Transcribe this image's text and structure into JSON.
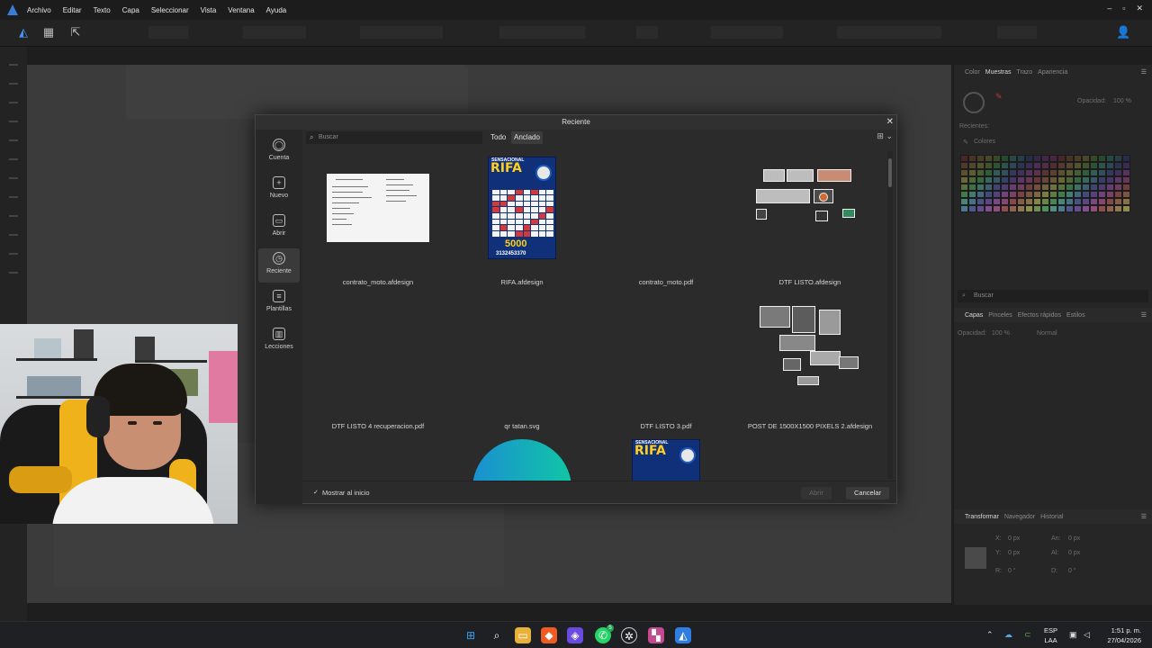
{
  "menu": [
    "Archivo",
    "Editar",
    "Texto",
    "Capa",
    "Seleccionar",
    "Vista",
    "Ventana",
    "Ayuda"
  ],
  "window_controls": [
    "–",
    "▫",
    "✕"
  ],
  "color_panel": {
    "tabs": [
      "Color",
      "Muestras",
      "Trazo",
      "Apariencia"
    ],
    "active_tab": "Muestras",
    "opacity_label": "Opacidad:",
    "opacity_value": "100 %",
    "recent_label": "Recientes:",
    "palette_label": "Colores",
    "search_placeholder": "Buscar"
  },
  "layers_panel": {
    "tabs": [
      "Capas",
      "Pinceles",
      "Efectos rápidos",
      "Estilos"
    ],
    "active_tab": "Capas",
    "opacity_label": "Opacidad:",
    "opacity_value": "100 %",
    "blend_mode": "Normal"
  },
  "transform_panel": {
    "tabs": [
      "Transformar",
      "Navegador",
      "Historial"
    ],
    "active_tab": "Transformar",
    "x_label": "X:",
    "x_value": "0 px",
    "y_label": "Y:",
    "y_value": "0 px",
    "w_label": "An:",
    "w_value": "0 px",
    "h_label": "Al:",
    "h_value": "0 px",
    "r_label": "R:",
    "r_value": "0 °",
    "s_label": "D:",
    "s_value": "0 °"
  },
  "dialog": {
    "title": "Reciente",
    "close": "✕",
    "sidebar": [
      {
        "label": "Cuenta",
        "icon": "user-icon",
        "glyph": "◯"
      },
      {
        "label": "Nuevo",
        "icon": "new-document-icon",
        "glyph": "+"
      },
      {
        "label": "Abrir",
        "icon": "folder-icon",
        "glyph": "▭"
      },
      {
        "label": "Reciente",
        "icon": "clock-icon",
        "glyph": "◷"
      },
      {
        "label": "Plantillas",
        "icon": "templates-icon",
        "glyph": "≡"
      },
      {
        "label": "Lecciones",
        "icon": "book-icon",
        "glyph": "▥"
      }
    ],
    "active_sidebar": "Reciente",
    "search_placeholder": "Buscar",
    "filter_tabs": [
      "Todo",
      "Anclado"
    ],
    "active_filter": "Anclado",
    "view_toggle": "⊞ ⌄",
    "files": [
      {
        "name": "contrato_moto.afdesign",
        "thumb": "document"
      },
      {
        "name": "RIFA.afdesign",
        "thumb": "rifa"
      },
      {
        "name": "contrato_moto.pdf",
        "thumb": "empty"
      },
      {
        "name": "DTF LISTO.afdesign",
        "thumb": "collage"
      },
      {
        "name": "DTF LISTO 4 recuperacion.pdf",
        "thumb": "empty"
      },
      {
        "name": "qr tatan.svg",
        "thumb": "empty"
      },
      {
        "name": "DTF LISTO 3.pdf",
        "thumb": "empty"
      },
      {
        "name": "POST DE 1500X1500 PIXELS 2.afdesign",
        "thumb": "collage2"
      },
      {
        "name": "",
        "thumb": "empty"
      },
      {
        "name": "",
        "thumb": "qr-arc"
      },
      {
        "name": "",
        "thumb": "rifa-small"
      },
      {
        "name": "",
        "thumb": "empty"
      }
    ],
    "rifa": {
      "sub": "SENSACIONAL",
      "title": "RIFA",
      "prize": "5000",
      "phone": "3132453370"
    },
    "show_on_start_label": "Mostrar al inicio",
    "show_on_start_checked": true,
    "open_button": "Abrir",
    "cancel_button": "Cancelar"
  },
  "taskbar": {
    "language": "ESP",
    "layout": "LAA",
    "time": "1:51 p. m.",
    "date": "27/04/2026",
    "whatsapp_badge": "5"
  }
}
